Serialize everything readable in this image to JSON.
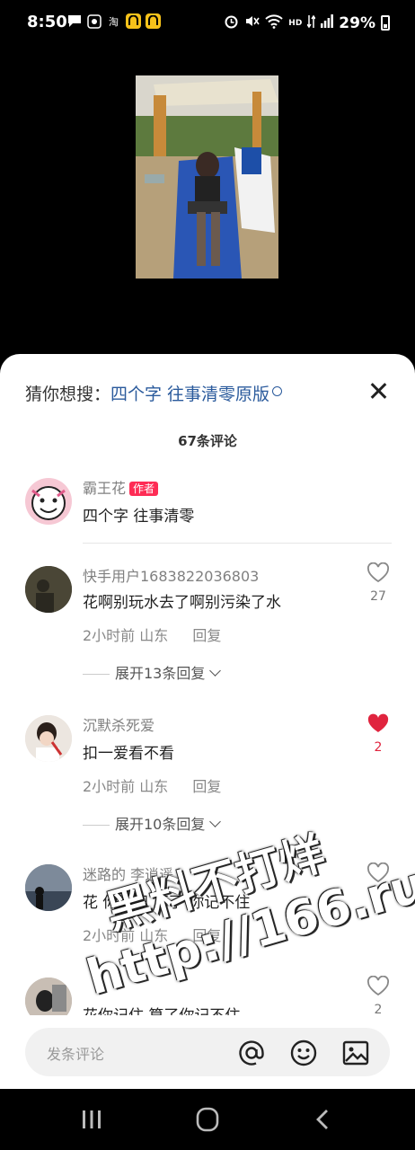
{
  "status": {
    "time": "8:50",
    "battery": "29%",
    "hd": "HD",
    "taobao": "淘"
  },
  "guess": {
    "prefix": "猜你想搜：",
    "keyword": "四个字 往事清零原版"
  },
  "comment_count": "67条评论",
  "comments": [
    {
      "user": "霸王花",
      "tag": "作者",
      "text": "四个字 往事清零"
    },
    {
      "user": "快手用户1683822036803",
      "text": "花啊别玩水去了啊别污染了水",
      "time": "2小时前",
      "location": "山东",
      "reply": "回复",
      "likes": "27",
      "liked": false,
      "expand": "展开13条回复"
    },
    {
      "user": "沉默杀死爱",
      "text": "扣一爱看不看",
      "time": "2小时前",
      "location": "山东",
      "reply": "回复",
      "likes": "2",
      "liked": true,
      "expand": "展开10条回复"
    },
    {
      "user": "迷路的 李逍遥.",
      "text": "花 你切记 算了 你记不住",
      "time": "2小时前",
      "location": "山东",
      "reply": "回复",
      "likes": "5",
      "liked": false
    },
    {
      "user": "",
      "text": "花你记住 算了你记不住",
      "likes": "2",
      "liked": false
    }
  ],
  "input": {
    "placeholder": "发条评论"
  },
  "watermark": {
    "line1": "黑料不打烊",
    "line2": "http://166.run"
  },
  "colors": {
    "keyword": "#2a5a9c",
    "tag": "#fe2c55",
    "liked": "#e0243e"
  }
}
